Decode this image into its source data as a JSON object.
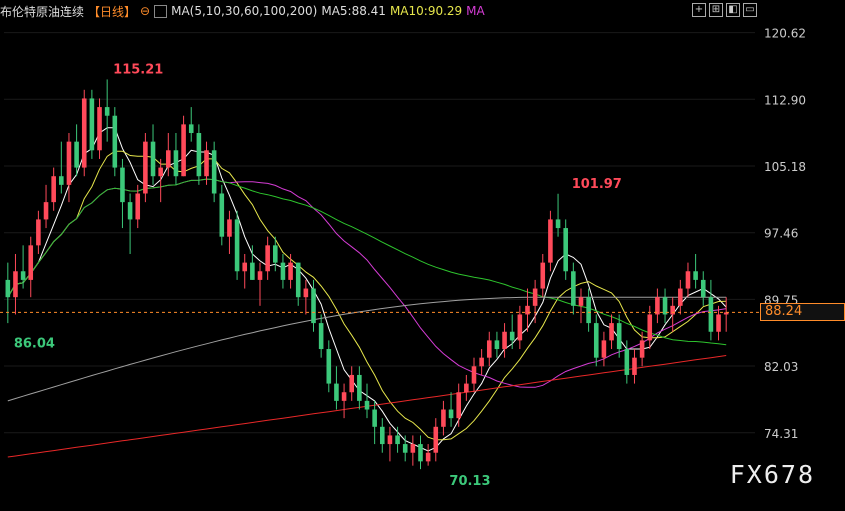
{
  "header": {
    "title": "布伦特原油连续",
    "period": "【日线】",
    "ma_label": "MA(5,10,30,60,100,200)",
    "ma5": "MA5:88.41",
    "ma10": "MA10:90.29",
    "ma_more": "MA"
  },
  "watermark": "FX678",
  "colors": {
    "up": "#ff4a5a",
    "down": "#3cc87a",
    "ma5": "#ffffff",
    "ma10": "#e6e64c",
    "ma30": "#d43cd4",
    "ma60": "#2ec42e",
    "ma100": "#a0a0a0",
    "ma200": "#e82828",
    "current_line": "#ff8c2a"
  },
  "chart_data": {
    "type": "candlestick",
    "y_ticks": [
      "120.62",
      "112.90",
      "105.18",
      "97.46",
      "89.75",
      "82.03",
      "74.31"
    ],
    "ylim": [
      70.0,
      121.5
    ],
    "current_price": "88.24",
    "annotations": [
      {
        "text": "115.21",
        "candle": 13,
        "value": 115.21
      },
      {
        "text": "101.97",
        "candle": 73,
        "value": 101.97
      },
      {
        "text": "86.04",
        "candle": 0,
        "value": 86.04
      },
      {
        "text": "70.13",
        "candle": 57,
        "value": 70.13
      }
    ],
    "candles": [
      [
        92,
        94,
        87,
        90
      ],
      [
        90,
        95,
        88,
        93
      ],
      [
        93,
        96,
        91,
        92
      ],
      [
        92,
        97,
        90,
        96
      ],
      [
        96,
        100,
        95,
        99
      ],
      [
        99,
        103,
        98,
        101
      ],
      [
        101,
        105,
        100,
        104
      ],
      [
        104,
        108,
        102,
        103
      ],
      [
        103,
        109,
        101,
        108
      ],
      [
        108,
        110,
        104,
        105
      ],
      [
        105,
        114,
        104,
        113
      ],
      [
        113,
        114,
        106,
        107
      ],
      [
        107,
        113,
        106,
        112
      ],
      [
        112,
        115.2,
        108,
        111
      ],
      [
        111,
        112,
        104,
        105
      ],
      [
        105,
        106,
        98,
        101
      ],
      [
        101,
        102,
        95,
        99
      ],
      [
        99,
        103,
        98,
        102
      ],
      [
        102,
        109,
        101,
        108
      ],
      [
        108,
        110,
        103,
        104
      ],
      [
        104,
        106,
        101,
        105
      ],
      [
        105,
        109,
        104,
        107
      ],
      [
        107,
        109,
        103,
        104
      ],
      [
        104,
        111,
        104,
        110
      ],
      [
        110,
        112,
        108,
        109
      ],
      [
        109,
        110,
        103,
        104
      ],
      [
        104,
        108,
        103,
        107
      ],
      [
        107,
        108,
        101,
        102
      ],
      [
        102,
        103,
        96,
        97
      ],
      [
        97,
        100,
        95,
        99
      ],
      [
        99,
        100,
        92,
        93
      ],
      [
        93,
        95,
        91,
        94
      ],
      [
        94,
        96,
        92,
        92
      ],
      [
        92,
        94,
        89,
        93
      ],
      [
        93,
        97,
        92,
        96
      ],
      [
        96,
        97,
        93,
        94
      ],
      [
        94,
        95,
        91,
        92
      ],
      [
        92,
        95,
        91,
        94
      ],
      [
        94,
        94,
        89,
        90
      ],
      [
        90,
        92,
        88,
        91
      ],
      [
        91,
        92,
        86,
        87
      ],
      [
        87,
        88,
        83,
        84
      ],
      [
        84,
        85,
        79,
        80
      ],
      [
        80,
        82,
        77,
        78
      ],
      [
        78,
        80,
        76,
        79
      ],
      [
        79,
        82,
        78,
        81
      ],
      [
        81,
        82,
        77,
        78
      ],
      [
        78,
        80,
        76,
        77
      ],
      [
        77,
        78,
        73,
        75
      ],
      [
        75,
        76,
        72,
        73
      ],
      [
        73,
        75,
        71,
        74
      ],
      [
        74,
        75,
        72,
        73
      ],
      [
        73,
        74,
        71,
        72
      ],
      [
        72,
        74,
        70.5,
        73
      ],
      [
        73,
        74,
        70.1,
        71
      ],
      [
        71,
        73,
        70.5,
        72
      ],
      [
        72,
        76,
        71,
        75
      ],
      [
        75,
        78,
        74,
        77
      ],
      [
        77,
        79,
        75,
        76
      ],
      [
        76,
        80,
        75,
        79
      ],
      [
        79,
        81,
        78,
        80
      ],
      [
        80,
        83,
        79,
        82
      ],
      [
        82,
        84,
        81,
        83
      ],
      [
        83,
        86,
        82,
        85
      ],
      [
        85,
        86,
        83,
        84
      ],
      [
        84,
        87,
        83,
        86
      ],
      [
        86,
        88,
        84,
        85
      ],
      [
        85,
        89,
        84,
        88
      ],
      [
        88,
        91,
        86,
        89
      ],
      [
        89,
        92,
        87,
        91
      ],
      [
        91,
        95,
        90,
        94
      ],
      [
        94,
        100,
        93,
        99
      ],
      [
        99,
        101.97,
        97,
        98
      ],
      [
        98,
        99,
        92,
        93
      ],
      [
        93,
        94,
        88,
        89
      ],
      [
        89,
        91,
        87,
        90
      ],
      [
        90,
        91,
        86,
        87
      ],
      [
        87,
        88,
        82,
        83
      ],
      [
        83,
        86,
        82,
        85
      ],
      [
        85,
        88,
        84,
        87
      ],
      [
        87,
        88,
        83,
        84
      ],
      [
        84,
        85,
        80,
        81
      ],
      [
        81,
        84,
        80,
        83
      ],
      [
        83,
        86,
        82,
        85
      ],
      [
        85,
        89,
        84,
        88
      ],
      [
        88,
        91,
        87,
        90
      ],
      [
        90,
        91,
        87,
        88
      ],
      [
        88,
        90,
        86,
        89
      ],
      [
        89,
        92,
        88,
        91
      ],
      [
        91,
        94,
        90,
        93
      ],
      [
        93,
        95,
        91,
        92
      ],
      [
        92,
        93,
        89,
        90
      ],
      [
        90,
        92,
        85,
        86
      ],
      [
        86,
        89,
        85,
        88
      ],
      [
        88,
        90,
        86,
        88.24
      ]
    ]
  }
}
